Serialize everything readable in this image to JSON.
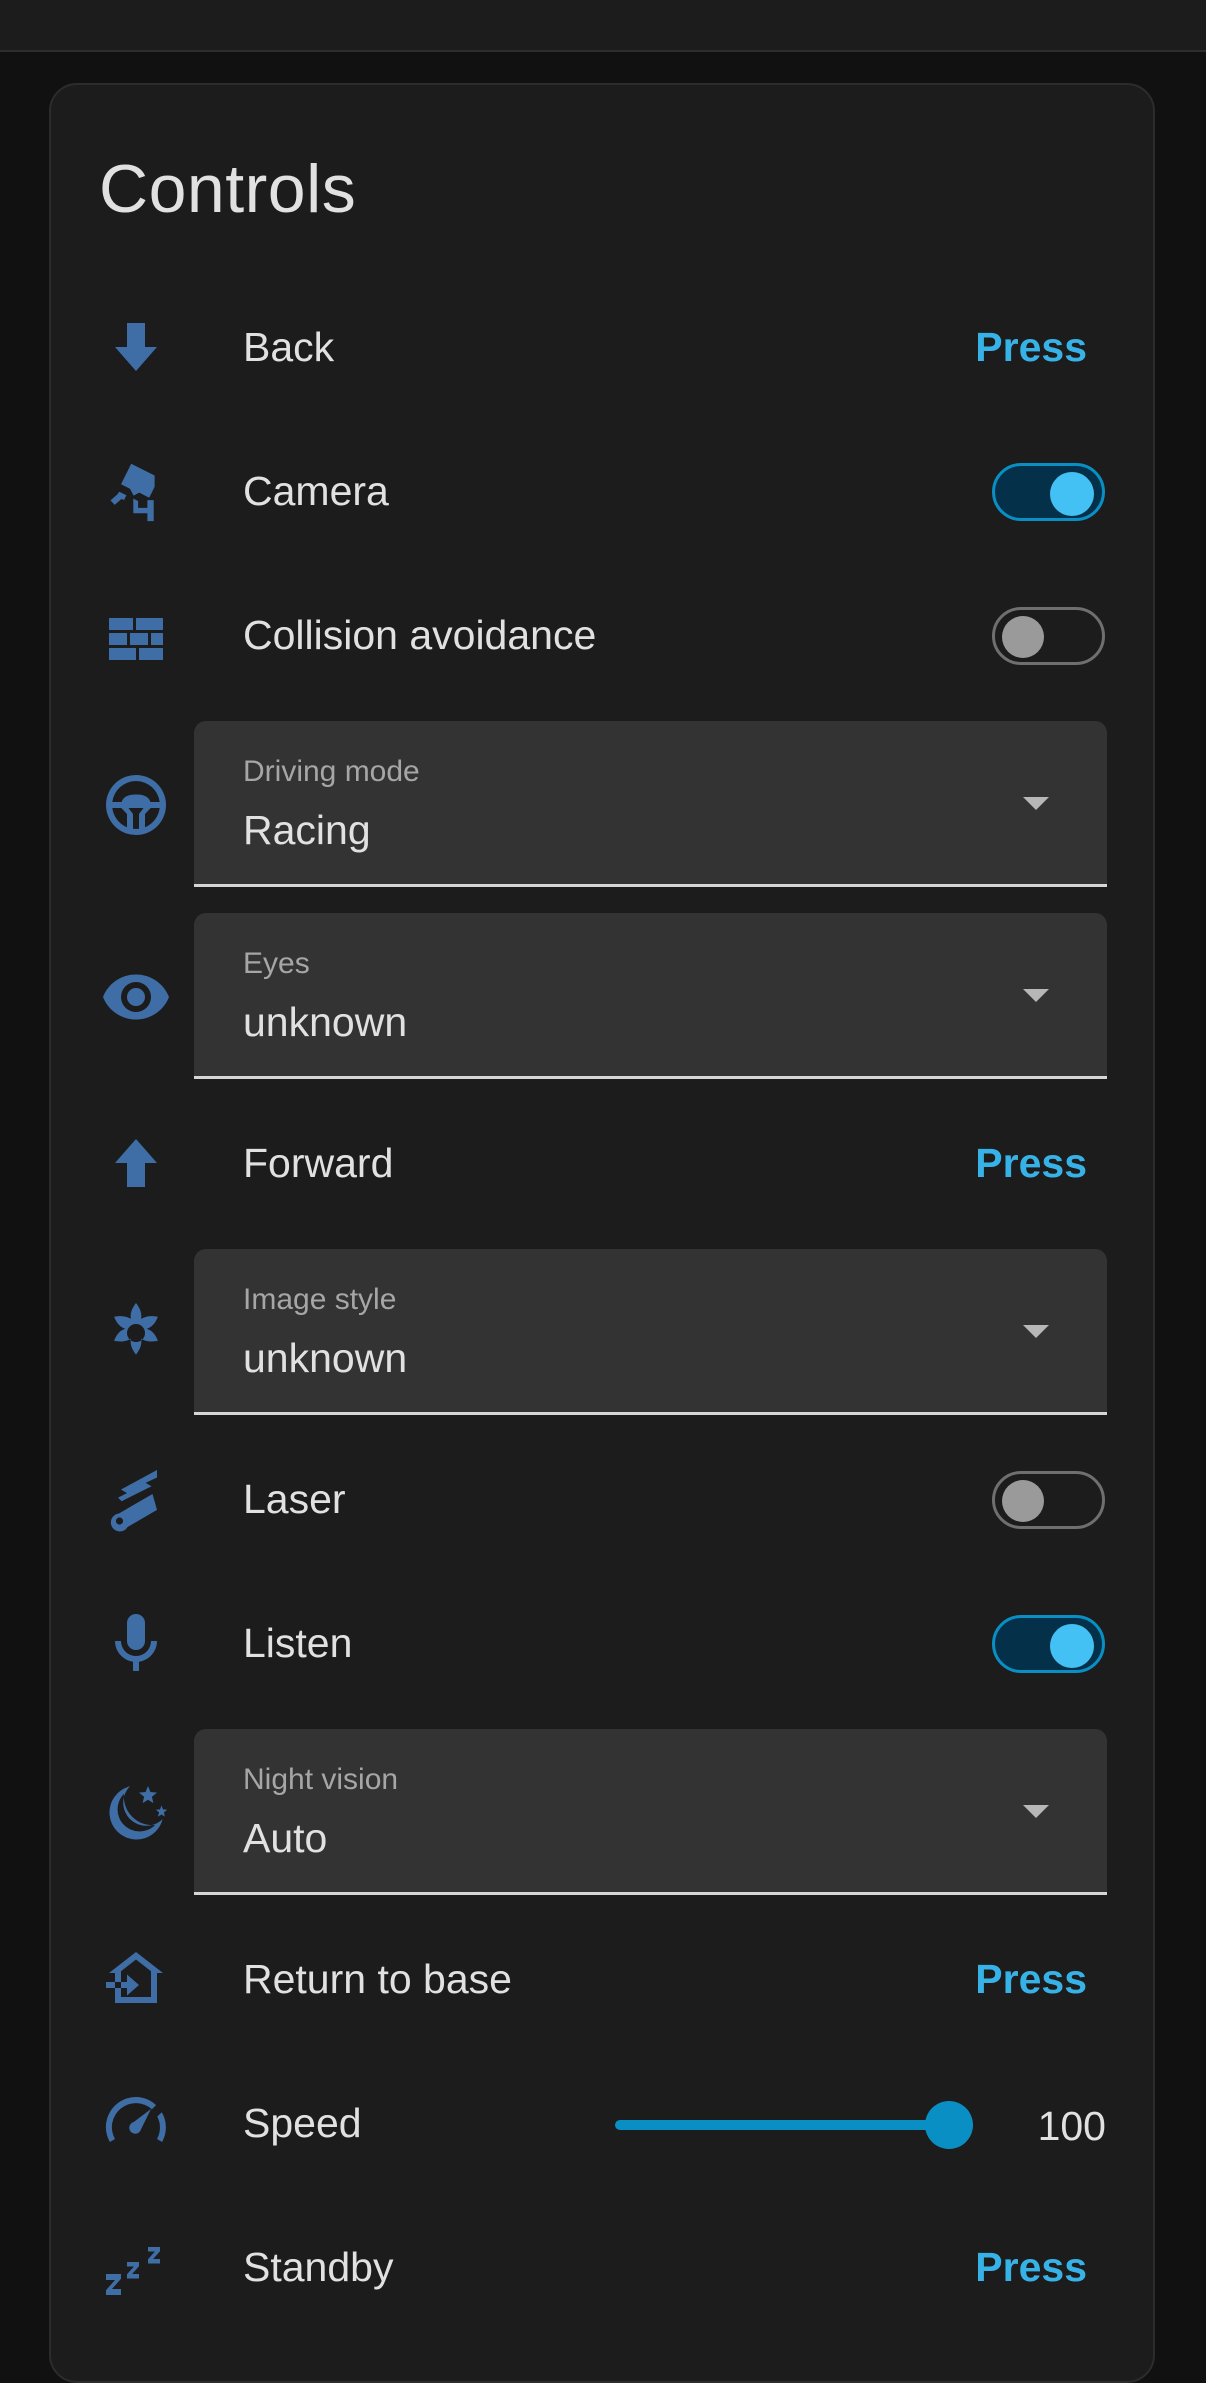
{
  "card": {
    "title": "Controls"
  },
  "colors": {
    "accent": "#37b2e7",
    "icon": "#3f6ea6",
    "toggle_on": "#43c1f5"
  },
  "rows": {
    "back": {
      "label": "Back",
      "action": "Press",
      "icon": "arrow-down-icon"
    },
    "camera": {
      "label": "Camera",
      "state": "on",
      "icon": "cctv-camera-icon"
    },
    "collision": {
      "label": "Collision avoidance",
      "state": "off",
      "icon": "brick-wall-icon"
    },
    "driving_mode": {
      "label": "Driving mode",
      "value": "Racing",
      "icon": "steering-wheel-icon"
    },
    "eyes": {
      "label": "Eyes",
      "value": "unknown",
      "icon": "eye-icon"
    },
    "forward": {
      "label": "Forward",
      "action": "Press",
      "icon": "arrow-up-icon"
    },
    "image_style": {
      "label": "Image style",
      "value": "unknown",
      "icon": "flower-icon"
    },
    "laser": {
      "label": "Laser",
      "state": "off",
      "icon": "laser-icon"
    },
    "listen": {
      "label": "Listen",
      "state": "on",
      "icon": "microphone-icon"
    },
    "night_vision": {
      "label": "Night vision",
      "value": "Auto",
      "icon": "moon-stars-icon"
    },
    "return_to_base": {
      "label": "Return to base",
      "action": "Press",
      "icon": "home-import-icon"
    },
    "speed": {
      "label": "Speed",
      "value": "100",
      "level_percent": 100,
      "icon": "speedometer-icon"
    },
    "standby": {
      "label": "Standby",
      "action": "Press",
      "icon": "sleep-zzz-icon"
    }
  }
}
